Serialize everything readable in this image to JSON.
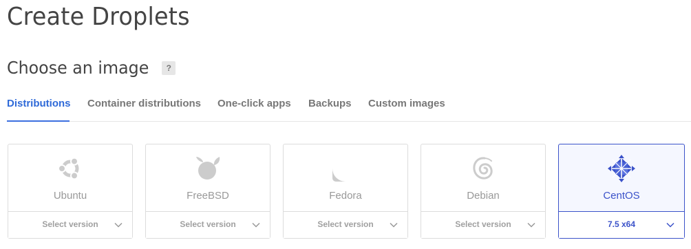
{
  "page": {
    "title": "Create Droplets"
  },
  "section": {
    "title": "Choose an image",
    "help_label": "?"
  },
  "tabs": [
    {
      "label": "Distributions",
      "active": true
    },
    {
      "label": "Container distributions",
      "active": false
    },
    {
      "label": "One-click apps",
      "active": false
    },
    {
      "label": "Backups",
      "active": false
    },
    {
      "label": "Custom images",
      "active": false
    }
  ],
  "distributions": [
    {
      "name": "Ubuntu",
      "icon": "ubuntu-icon",
      "version_label": "Select version",
      "selected": false
    },
    {
      "name": "FreeBSD",
      "icon": "freebsd-icon",
      "version_label": "Select version",
      "selected": false
    },
    {
      "name": "Fedora",
      "icon": "fedora-icon",
      "version_label": "Select version",
      "selected": false
    },
    {
      "name": "Debian",
      "icon": "debian-icon",
      "version_label": "Select version",
      "selected": false
    },
    {
      "name": "CentOS",
      "icon": "centos-icon",
      "version_label": "7.5 x64",
      "selected": true
    }
  ],
  "colors": {
    "accent": "#3b52c9",
    "tab_active": "#2f6ad8",
    "muted_icon": "#cccccc"
  }
}
